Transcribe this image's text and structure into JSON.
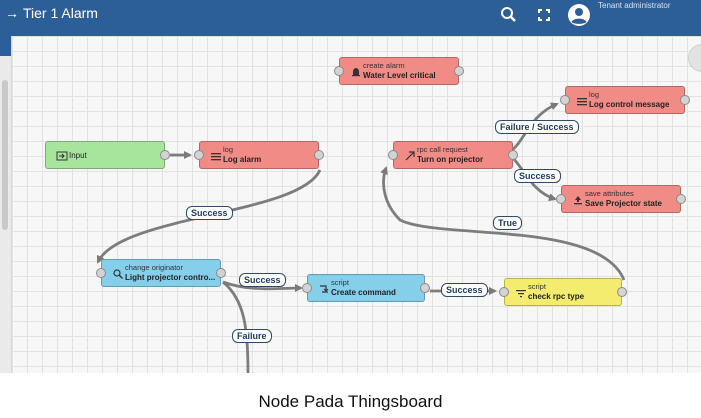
{
  "header": {
    "title": "Tier 1 Alarm",
    "user_label": "Tenant administrator"
  },
  "nodes": {
    "create_alarm": {
      "type": "create alarm",
      "name": "Water Level critical",
      "icon": "bell-icon"
    },
    "input": {
      "name": "Input",
      "icon": "input-icon"
    },
    "log_alarm": {
      "type": "log",
      "name": "Log alarm",
      "icon": "menu-lines-icon"
    },
    "rpc_call": {
      "type": "rpc call request",
      "name": "Turn on projector",
      "icon": "arrow-up-right-icon"
    },
    "log_control": {
      "type": "log",
      "name": "Log control message",
      "icon": "menu-lines-icon"
    },
    "save_attributes": {
      "type": "save attributes",
      "name": "Save Projector state",
      "icon": "upload-icon"
    },
    "change_originator": {
      "type": "change originator",
      "name": "Light projector contro...",
      "icon": "search-icon"
    },
    "script_create": {
      "type": "script",
      "name": "Create command",
      "icon": "transform-icon"
    },
    "script_check": {
      "type": "script",
      "name": "check rpc type",
      "icon": "filter-icon"
    }
  },
  "links": {
    "success_1": "Success",
    "success_2": "Success",
    "success_3": "Success",
    "success_4": "Success",
    "failure": "Failure",
    "failure_success": "Failure / Success",
    "true": "True"
  },
  "caption": "Node Pada Thingsboard",
  "colors": {
    "header": "#2c5f97",
    "alarm_node": "#f08b86",
    "input_node": "#a7e49c",
    "transform_node": "#85cfea",
    "filter_node": "#f4ec6e"
  }
}
